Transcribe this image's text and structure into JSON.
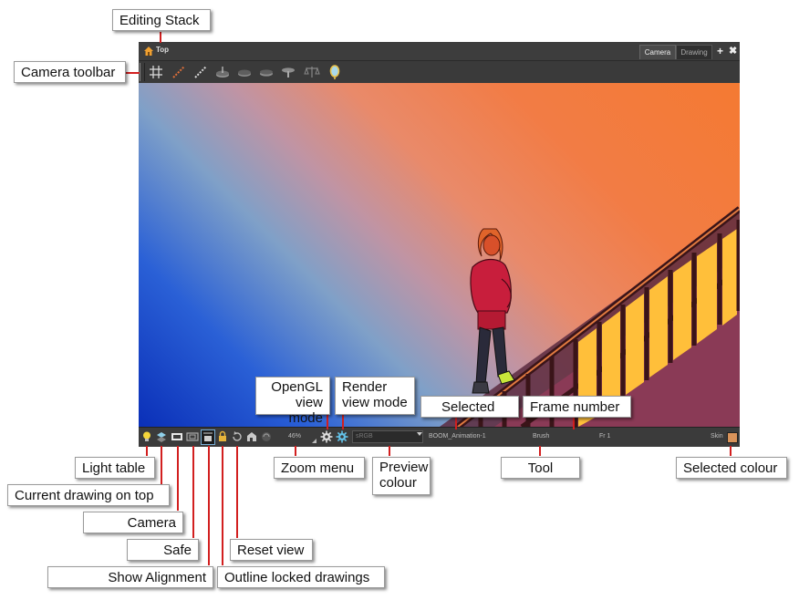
{
  "window": {
    "editing_stack": "Top",
    "tabs": [
      {
        "label": "Camera",
        "active": true
      },
      {
        "label": "Drawing",
        "active": false
      }
    ],
    "add_view_symbol": "+",
    "close_symbol": "✖"
  },
  "toolbar": {
    "icons": [
      "grid-icon",
      "onion-skin-icon",
      "light-table-strip-icon",
      "turn-table-icon",
      "reset-rotation-icon",
      "flip-icon",
      "reset-zoom-icon",
      "balance-icon",
      "mirror-icon"
    ]
  },
  "statusbar": {
    "zoom": "46%",
    "preview_colour": "sRGB",
    "selected": "BOOM_Animation-1",
    "tool": "Brush",
    "frame": "Fr 1",
    "colour_name": "Skin",
    "colour_hex": "#d9935a"
  },
  "callouts": {
    "editing_stack": "Editing Stack",
    "camera_toolbar": "Camera toolbar",
    "opengl_view_mode": "OpenGL view mode",
    "render_view_mode": "Render view mode",
    "selected": "Selected",
    "frame_number": "Frame number",
    "light_table": "Light table",
    "current_drawing_on_top": "Current drawing on top",
    "camera": "Camera",
    "safe": "Safe",
    "show_alignment": "Show Alignment",
    "outline_locked_drawings": "Outline locked drawings",
    "reset_view": "Reset view",
    "zoom_menu": "Zoom menu",
    "preview_colour": "Preview colour",
    "tool": "Tool",
    "selected_colour": "Selected colour"
  }
}
